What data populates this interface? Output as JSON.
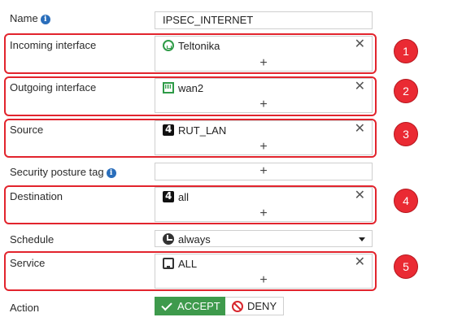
{
  "name": {
    "label": "Name",
    "info_icon": "i",
    "value": "IPSEC_INTERNET"
  },
  "incoming_interface": {
    "label": "Incoming interface",
    "entry": "Teltonika",
    "icon": "tunnel-icon",
    "remove": "✕",
    "add": "+"
  },
  "outgoing_interface": {
    "label": "Outgoing interface",
    "entry": "wan2",
    "icon": "port-icon",
    "remove": "✕",
    "add": "+"
  },
  "source": {
    "label": "Source",
    "entry": "RUT_LAN",
    "icon": "address-icon",
    "remove": "✕",
    "add": "+"
  },
  "security_posture_tag": {
    "label": "Security posture tag",
    "info_icon": "i",
    "add": "+"
  },
  "destination": {
    "label": "Destination",
    "entry": "all",
    "icon": "address-icon",
    "remove": "✕",
    "add": "+"
  },
  "schedule": {
    "label": "Schedule",
    "value": "always",
    "icon": "clock-icon"
  },
  "service": {
    "label": "Service",
    "entry": "ALL",
    "icon": "service-icon",
    "remove": "✕",
    "add": "+"
  },
  "action": {
    "label": "Action",
    "accept_label": "ACCEPT",
    "deny_label": "DENY",
    "selected": "ACCEPT"
  },
  "annotations": {
    "badges": [
      "1",
      "2",
      "3",
      "4",
      "5"
    ],
    "color": "#e2242d"
  },
  "colors": {
    "accept": "#3e9a4c",
    "deny": "#d8262d",
    "info": "#2a6ebb"
  }
}
